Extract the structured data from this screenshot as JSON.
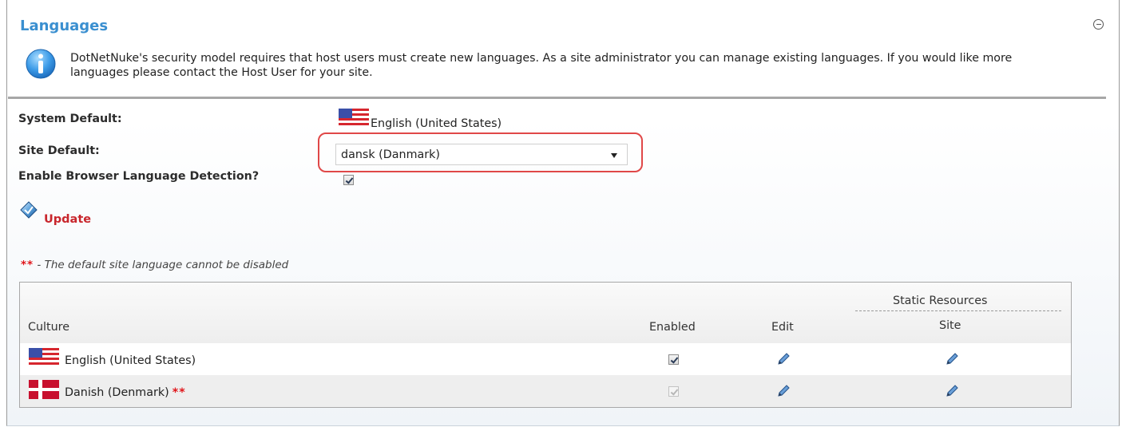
{
  "panel": {
    "title": "Languages",
    "info_text": "DotNetNuke's security model requires that host users must create new languages. As a site administrator you can manage existing languages. If you would like more languages please contact the Host User for your site."
  },
  "settings": {
    "system_default_label": "System Default:",
    "system_default_value": "English (United States)",
    "site_default_label": "Site Default:",
    "site_default_value": "dansk (Danmark)",
    "browser_detection_label": "Enable Browser Language Detection?",
    "browser_detection_checked": true
  },
  "actions": {
    "update_label": "Update"
  },
  "note": {
    "stars": "**",
    "text": " - The default site language cannot be disabled"
  },
  "table": {
    "headers": {
      "culture": "Culture",
      "enabled": "Enabled",
      "edit": "Edit",
      "static_resources": "Static Resources",
      "site": "Site"
    },
    "rows": [
      {
        "culture": "English (United States)",
        "flag": "us-flag-icon",
        "enabled": true,
        "enabled_locked": false,
        "stars": ""
      },
      {
        "culture": "Danish (Denmark)",
        "flag": "dk-flag-icon",
        "enabled": true,
        "enabled_locked": true,
        "stars": "**"
      }
    ]
  },
  "colors": {
    "title": "#3a8fd0",
    "update_link": "#c8262c",
    "highlight": "#e04848",
    "required_stars": "#e0151a"
  }
}
